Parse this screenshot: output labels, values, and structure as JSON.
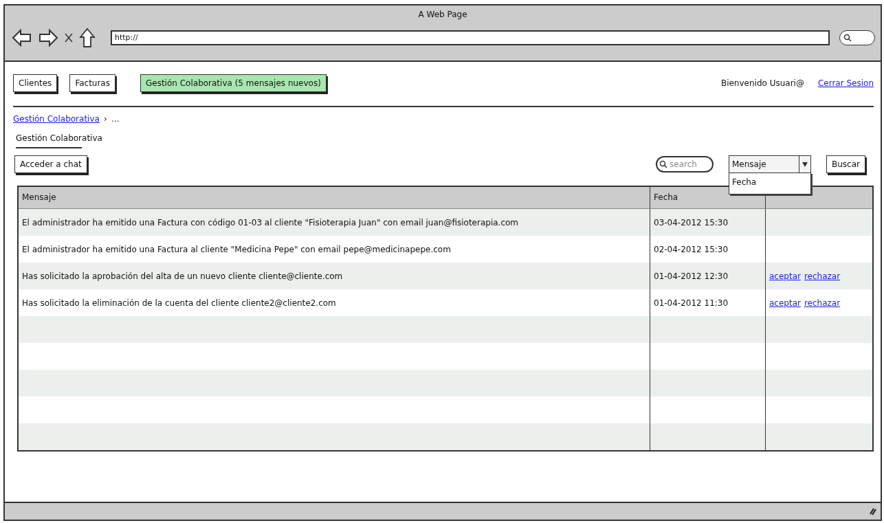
{
  "window": {
    "title": "A Web Page"
  },
  "browser": {
    "url": "http://"
  },
  "nav": {
    "buttons": [
      {
        "label": "Clientes",
        "selected": false
      },
      {
        "label": "Facturas",
        "selected": false
      },
      {
        "label": "Gestión Colaborativa (5 mensajes nuevos)",
        "selected": true
      }
    ],
    "welcome": "Bienvenido Usuari@",
    "logout": "Cerrar Sesion"
  },
  "breadcrumb": {
    "link": "Gestión Colaborativa",
    "separator": "›",
    "trailing": "…"
  },
  "heading": "Gestión Colaborativa",
  "toolbar": {
    "chat_button": "Acceder a chat",
    "search": {
      "placeholder": "search"
    },
    "sort": {
      "value": "Mensaje",
      "expanded": true,
      "options": [
        "Fecha"
      ]
    },
    "search_button": "Buscar"
  },
  "table": {
    "columns": [
      "Mensaje",
      "Fecha"
    ],
    "rows": [
      {
        "message": "El administrador ha emitido una Factura con código 01-03 al cliente \"Fisioterapia Juan\" con email juan@fisioterapia.com",
        "date": "03-04-2012 15:30",
        "actions": []
      },
      {
        "message": "El administrador ha emitido una Factura al cliente \"Medicina Pepe\" con email pepe@medicinapepe.com",
        "date": "02-04-2012 15:30",
        "actions": []
      },
      {
        "message": "Has solicitado la aprobación del alta de un nuevo cliente cliente@cliente.com",
        "date": "01-04-2012 12:30",
        "actions": [
          "aceptar",
          "rechazar"
        ]
      },
      {
        "message": "Has solicitado la eliminación de la cuenta del cliente cliente2@cliente2.com",
        "date": "01-04-2012 11:30",
        "actions": [
          "aceptar",
          "rechazar"
        ]
      }
    ]
  }
}
